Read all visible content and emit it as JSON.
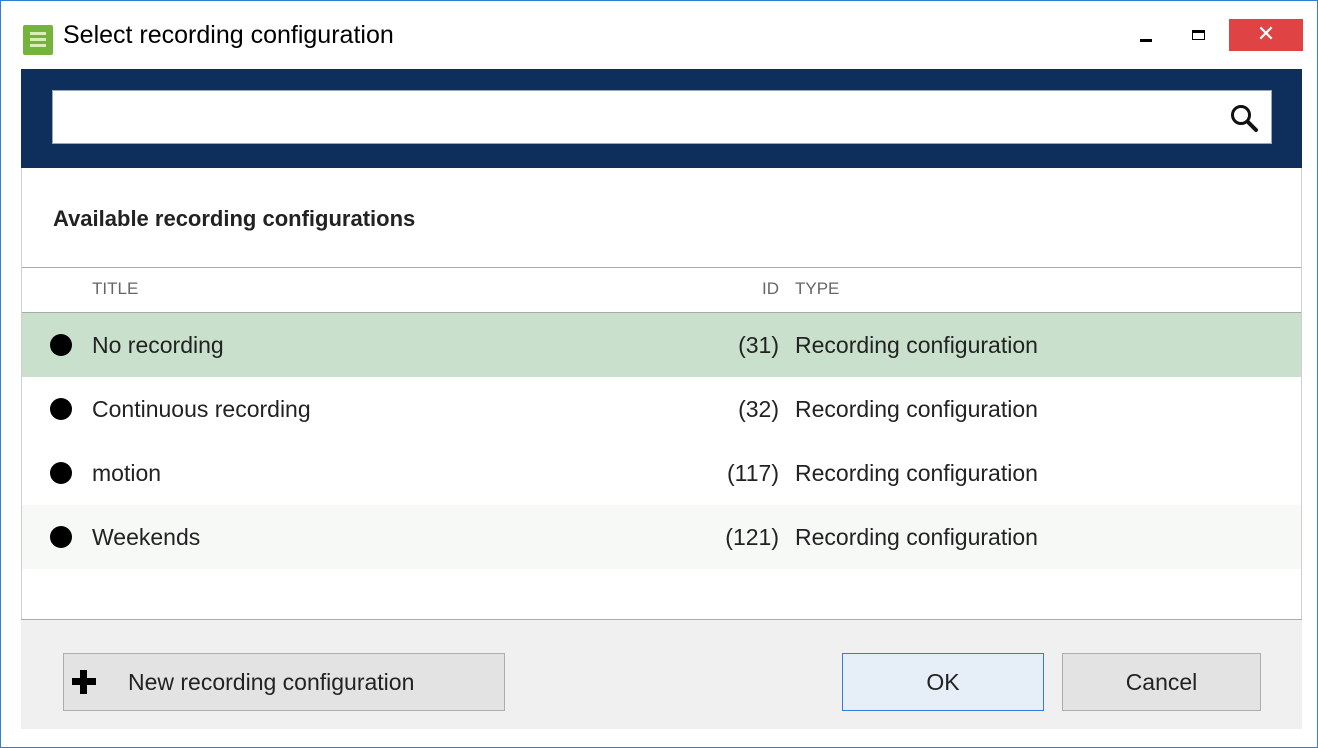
{
  "window": {
    "title": "Select recording configuration",
    "close_glyph": "✕"
  },
  "search": {
    "value": "",
    "placeholder": ""
  },
  "section": {
    "title": "Available recording configurations"
  },
  "columns": {
    "title": "TITLE",
    "id": "ID",
    "type": "TYPE"
  },
  "rows": [
    {
      "title": "No recording",
      "id": "(31)",
      "type": "Recording configuration",
      "selected": true
    },
    {
      "title": "Continuous recording",
      "id": "(32)",
      "type": "Recording configuration",
      "selected": false
    },
    {
      "title": "motion",
      "id": "(117)",
      "type": "Recording configuration",
      "selected": false
    },
    {
      "title": "Weekends",
      "id": "(121)",
      "type": "Recording configuration",
      "selected": false
    }
  ],
  "footer": {
    "new_label": "New recording configuration",
    "ok_label": "OK",
    "cancel_label": "Cancel"
  },
  "colors": {
    "header_band": "#0e2f5b",
    "selected_row": "#c9e1cc",
    "close_button": "#e04343",
    "accent_border": "#2f7fd8",
    "app_icon": "#74b43c"
  },
  "icons": [
    "app-icon",
    "minimize-icon",
    "maximize-icon",
    "close-icon",
    "search-icon",
    "status-dot-icon",
    "plus-icon"
  ]
}
